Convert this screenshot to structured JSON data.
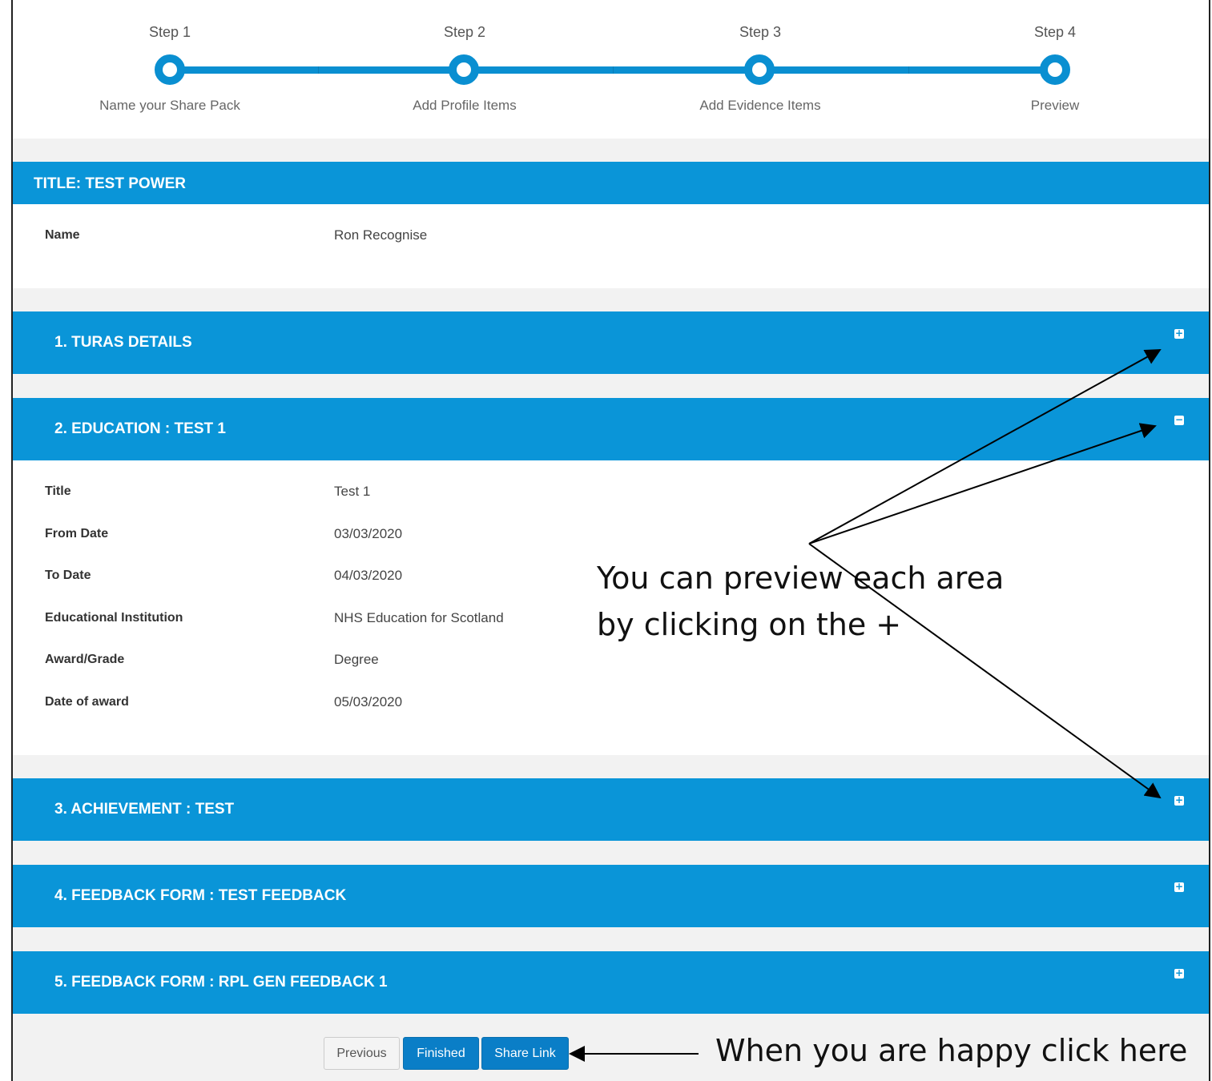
{
  "steps": [
    {
      "label": "Step 1",
      "caption": "Name your Share Pack"
    },
    {
      "label": "Step 2",
      "caption": "Add Profile Items"
    },
    {
      "label": "Step 3",
      "caption": "Add Evidence Items"
    },
    {
      "label": "Step 4",
      "caption": "Preview"
    }
  ],
  "title_panel": {
    "title": "TITLE: TEST POWER",
    "name_label": "Name",
    "name_value": "Ron Recognise"
  },
  "sections": [
    {
      "title": "1.  TURAS DETAILS",
      "toggle": "+"
    },
    {
      "title": "2.  EDUCATION : TEST 1",
      "toggle": "−"
    },
    {
      "title": "3.  ACHIEVEMENT : TEST",
      "toggle": "+"
    },
    {
      "title": "4.  FEEDBACK FORM : TEST FEEDBACK",
      "toggle": "+"
    },
    {
      "title": "5.  FEEDBACK FORM : RPL GEN FEEDBACK 1",
      "toggle": "+"
    }
  ],
  "education": {
    "rows": [
      {
        "label": "Title",
        "value": "Test 1"
      },
      {
        "label": "From Date",
        "value": "03/03/2020"
      },
      {
        "label": "To Date",
        "value": "04/03/2020"
      },
      {
        "label": "Educational Institution",
        "value": "NHS Education for Scotland"
      },
      {
        "label": "Award/Grade",
        "value": "Degree"
      },
      {
        "label": "Date of award",
        "value": "05/03/2020"
      }
    ]
  },
  "buttons": {
    "previous": "Previous",
    "finished": "Finished",
    "share_link": "Share Link"
  },
  "annotations": {
    "preview_line1": "You can preview each area",
    "preview_line2": "by clicking on the +",
    "happy": "When you are happy click here"
  },
  "colors": {
    "accent": "#0a95d8",
    "button_primary": "#0a7ec7"
  }
}
